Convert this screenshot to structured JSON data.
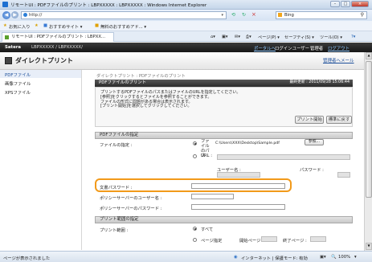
{
  "window": {
    "title": "リモートUI : PDFファイルのプリント : LBPXXXXX : LBPXXXXX : Windows Internet Explorer"
  },
  "address": {
    "url": "http://",
    "search_text": "Bing"
  },
  "favorites": {
    "label": "お気に入り",
    "suggested": "おすすめサイト ▾",
    "free_hotmail": "無料のおすすめアド... ▾"
  },
  "tab": {
    "label": "リモートUI : PDFファイルのプリント : LBPXX..."
  },
  "commands": {
    "page": "ページ(P) ▾",
    "safety": "セーフティ(S) ▾",
    "tools": "ツール(O) ▾",
    "help": "?▾"
  },
  "brand": {
    "name": "Satera",
    "model": "LBPXXXXX / LBPXXXXX/",
    "portal": "ポータルへ",
    "login_user": "ログインユーザー :",
    "admin": "管理者",
    "logout": "ログアウト"
  },
  "header": {
    "title": "ダイレクトプリント",
    "mail_link": "管理者へメール"
  },
  "sidebar": {
    "items": [
      "PDFファイル",
      "画像ファイル",
      "XPSファイル"
    ]
  },
  "content": {
    "breadcrumb": "ダイレクトプリント : PDFファイルのプリント",
    "section_title": "PDFファイルのプリント",
    "last_updated": "最終更新 : 2011/09/28 15:06:44",
    "description": "プリントするPDFファイルのパスまたはファイルのURLを指定してください。\n[参照]をクリックするとファイルを参照することができます。\nファイルの形式に問題がある場合は表示されます。\n[プリント開始]を選択してクリックしてください。",
    "start_print": "プリント開始",
    "reset": "標準に戻す",
    "file_section": "PDFファイルの指定",
    "file_label": "ファイルの指定 :",
    "opt_file": "ファイルのパス",
    "file_path": "C:\\Users\\XXX\\Desktop\\Sample.pdf",
    "browse": "参照...",
    "opt_url": "URL :",
    "user_name": "ユーザー名 :",
    "password": "パスワード :",
    "doc_password": "文書パスワード :",
    "policy_user": "ポリシーサーバーのユーザー名 :",
    "policy_password": "ポリシーサーバーのパスワード :",
    "range_section": "プリント範囲の指定",
    "range_label": "プリント範囲 :",
    "opt_all": "すべて",
    "opt_pages": "ページ指定",
    "start_page": "開始ページ :",
    "end_page": "終了ページ :"
  },
  "status": {
    "left": "ページが表示されました",
    "zone": "インターネット | 保護モード: 有効",
    "zoom": "100%"
  }
}
